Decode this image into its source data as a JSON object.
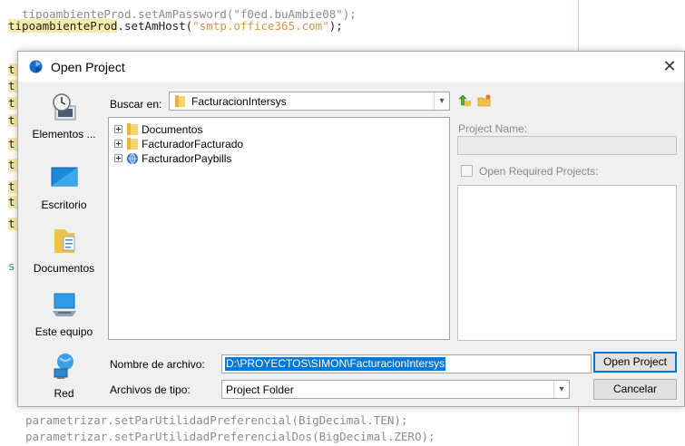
{
  "editor": {
    "line_top_partial": "tipoambienteProd.setAmPassword(\"f0ed.buAmbie08\");",
    "line_top_obj": "tipoambienteProd",
    "line_top_method": ".setAmHost(",
    "line_top_str": "\"smtp.office365.com\"",
    "line_top_end": ");",
    "gutter_letters": [
      "t",
      "t",
      "t",
      "t",
      "t",
      "t",
      "t",
      "t",
      "t",
      "s"
    ],
    "bottom_line_1": "parametrizar.setParUtilidadPreferencial(BigDecimal.TEN);",
    "bottom_line_2": "parametrizar.setParUtilidadPreferencialDos(BigDecimal.ZERO);"
  },
  "dialog": {
    "title": "Open Project",
    "close_glyph": "✕",
    "places": [
      {
        "label": "Elementos ...",
        "icon": "recent-items-icon"
      },
      {
        "label": "Escritorio",
        "icon": "desktop-icon"
      },
      {
        "label": "Documentos",
        "icon": "documents-icon"
      },
      {
        "label": "Este equipo",
        "icon": "computer-icon"
      },
      {
        "label": "Red",
        "icon": "network-icon"
      }
    ],
    "look_in_label": "Buscar en:",
    "look_in_value": "FacturacionIntersys",
    "files": [
      {
        "name": "Documentos",
        "icon": "folder-icon"
      },
      {
        "name": "FacturadorFacturado",
        "icon": "folder-icon"
      },
      {
        "name": "FacturadorPaybills",
        "icon": "project-icon"
      }
    ],
    "project_name_label": "Project Name:",
    "open_required_label": "Open Required Projects:",
    "file_name_label": "Nombre de archivo:",
    "file_name_value": "D:\\PROYECTOS\\SIMON\\FacturacionIntersys",
    "file_type_label": "Archivos de tipo:",
    "file_type_value": "Project Folder",
    "open_button": "Open Project",
    "cancel_button": "Cancelar",
    "colors": {
      "accent": "#0078d7",
      "folder": "#e8b43c",
      "highlight": "#f6ecaa"
    }
  }
}
